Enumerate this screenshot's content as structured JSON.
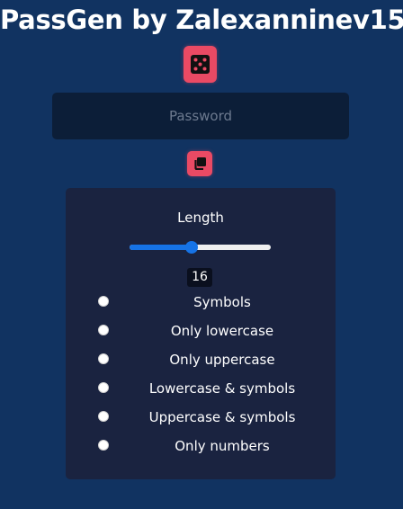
{
  "header": {
    "title": "PassGen by Zalexanninev15"
  },
  "generate_button": {
    "icon": "dice-icon",
    "color": "#ea4a64"
  },
  "password": {
    "value": "",
    "placeholder": "Password"
  },
  "copy_button": {
    "icon": "copy-icon",
    "color": "#ea4a64"
  },
  "settings": {
    "length_label": "Length",
    "length_value": "16",
    "slider": {
      "value": 16,
      "fraction": 0.44,
      "accent": "#1673e6"
    },
    "options": [
      {
        "label": "Symbols",
        "checked": false
      },
      {
        "label": "Only lowercase",
        "checked": false
      },
      {
        "label": "Only uppercase",
        "checked": false
      },
      {
        "label": "Lowercase & symbols",
        "checked": false
      },
      {
        "label": "Uppercase & symbols",
        "checked": false
      },
      {
        "label": "Only numbers",
        "checked": false
      }
    ]
  },
  "colors": {
    "background": "#113361",
    "panel": "#1a2340",
    "input": "#0c1e38",
    "accent": "#ea4a64"
  }
}
